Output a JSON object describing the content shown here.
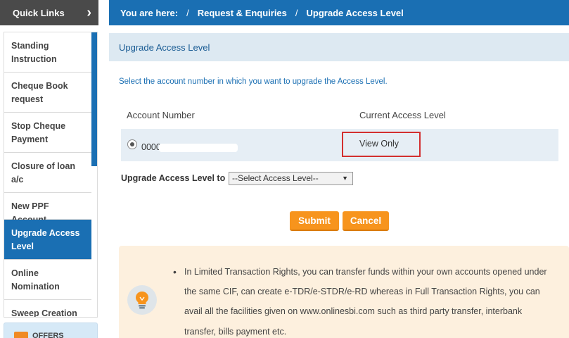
{
  "sidebar": {
    "header": "Quick Links",
    "items": [
      {
        "label": "Standing Instruction"
      },
      {
        "label": "Cheque Book request"
      },
      {
        "label": "Stop Cheque Payment"
      },
      {
        "label": "Closure of loan a/c"
      },
      {
        "label": "New PPF Account"
      },
      {
        "label": "Upgrade Access Level"
      },
      {
        "label": "Online Nomination"
      },
      {
        "label": "Sweep Creation"
      }
    ],
    "offers_label": "OFFERS"
  },
  "breadcrumb": {
    "prefix": "You are here:",
    "items": [
      "Request & Enquiries",
      "Upgrade Access Level"
    ]
  },
  "panel": {
    "title": "Upgrade Access Level",
    "instruction": "Select the account number in which you want to upgrade the Access Level.",
    "columns": {
      "account": "Account Number",
      "level": "Current Access Level"
    },
    "row": {
      "account_visible": "0000",
      "level": "View Only"
    },
    "upgrade_label": "Upgrade Access Level to",
    "select": {
      "value": "--Select Access Level--"
    },
    "buttons": {
      "submit": "Submit",
      "cancel": "Cancel"
    },
    "info": "In Limited Transaction Rights, you can transfer funds within your own accounts opened under the same CIF, can create e-TDR/e-STDR/e-RD whereas in Full Transaction Rights, you can avail all the facilities given on www.onlinesbi.com such as third party transfer, interbank transfer, bills payment etc."
  },
  "colors": {
    "primary": "#1a6fb3",
    "accent": "#f7941d",
    "highlight": "#d32f2f",
    "info_bg": "#fdf0de"
  }
}
